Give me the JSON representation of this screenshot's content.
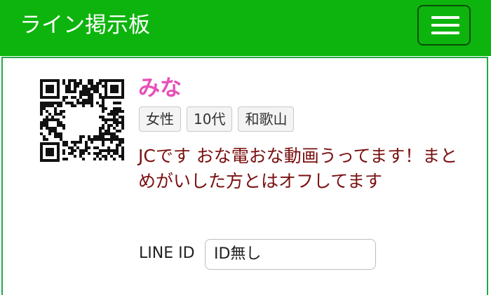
{
  "header": {
    "title": "ライン掲示板",
    "menu_icon": "hamburger-menu-icon",
    "color": "#0db40d"
  },
  "profile": {
    "qr_icon": "qr-code-icon",
    "name": "みな",
    "name_color": "#e84fb8",
    "tags": [
      "女性",
      "10代",
      "和歌山"
    ],
    "message": "JCです おな電おな動画うってます！まとめがいした方とはオフしてます",
    "message_color": "#7a1010",
    "line_id_label": "LINE ID",
    "line_id_value": "ID無し"
  }
}
